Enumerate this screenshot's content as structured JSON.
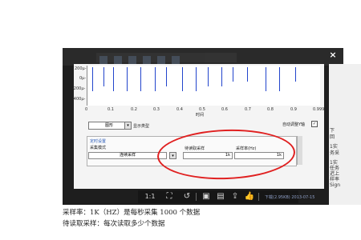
{
  "viewer": {
    "close_label": "×",
    "sliver_lines": [
      "下",
      "回",
      "1实",
      "务采",
      "",
      "1实",
      "任务",
      "迟上",
      "样率",
      "Sign"
    ]
  },
  "plot": {
    "y_ticks": [
      "200μ-",
      "0μ-",
      "-200μ-",
      "-400μ-"
    ],
    "x_ticks": [
      "0",
      "0.1",
      "0.2",
      "0.3",
      "0.4",
      "0.5",
      "0.6",
      "0.7",
      "0.8",
      "0.9",
      "0.999"
    ],
    "x_label": "时间",
    "spikes": [
      0.02,
      0.07,
      0.11,
      0.17,
      0.23,
      0.29,
      0.34,
      0.41,
      0.47,
      0.52,
      0.58,
      0.63,
      0.69,
      0.77,
      0.83,
      0.9
    ]
  },
  "controls": {
    "graph_select": "图形",
    "display_type_label": "显示类型",
    "autoscale_label": "自动调整Y轴",
    "autoscale_checked": "✓"
  },
  "timing": {
    "group_title": "定时设置",
    "mode_label": "采集模式",
    "mode_value": "连续采样",
    "samples_label": "待读取采样",
    "samples_value": "1k",
    "rate_label": "采样率(Hz)",
    "rate_value": "1k"
  },
  "viewer_bar": {
    "zoom": "1:1",
    "info": "下载(2.95KB)  2013-07-15"
  },
  "captions": [
    "采样率：1K（HZ）是每秒采集 1000 个数据",
    "待读取采样：每次读取多少个数据"
  ]
}
